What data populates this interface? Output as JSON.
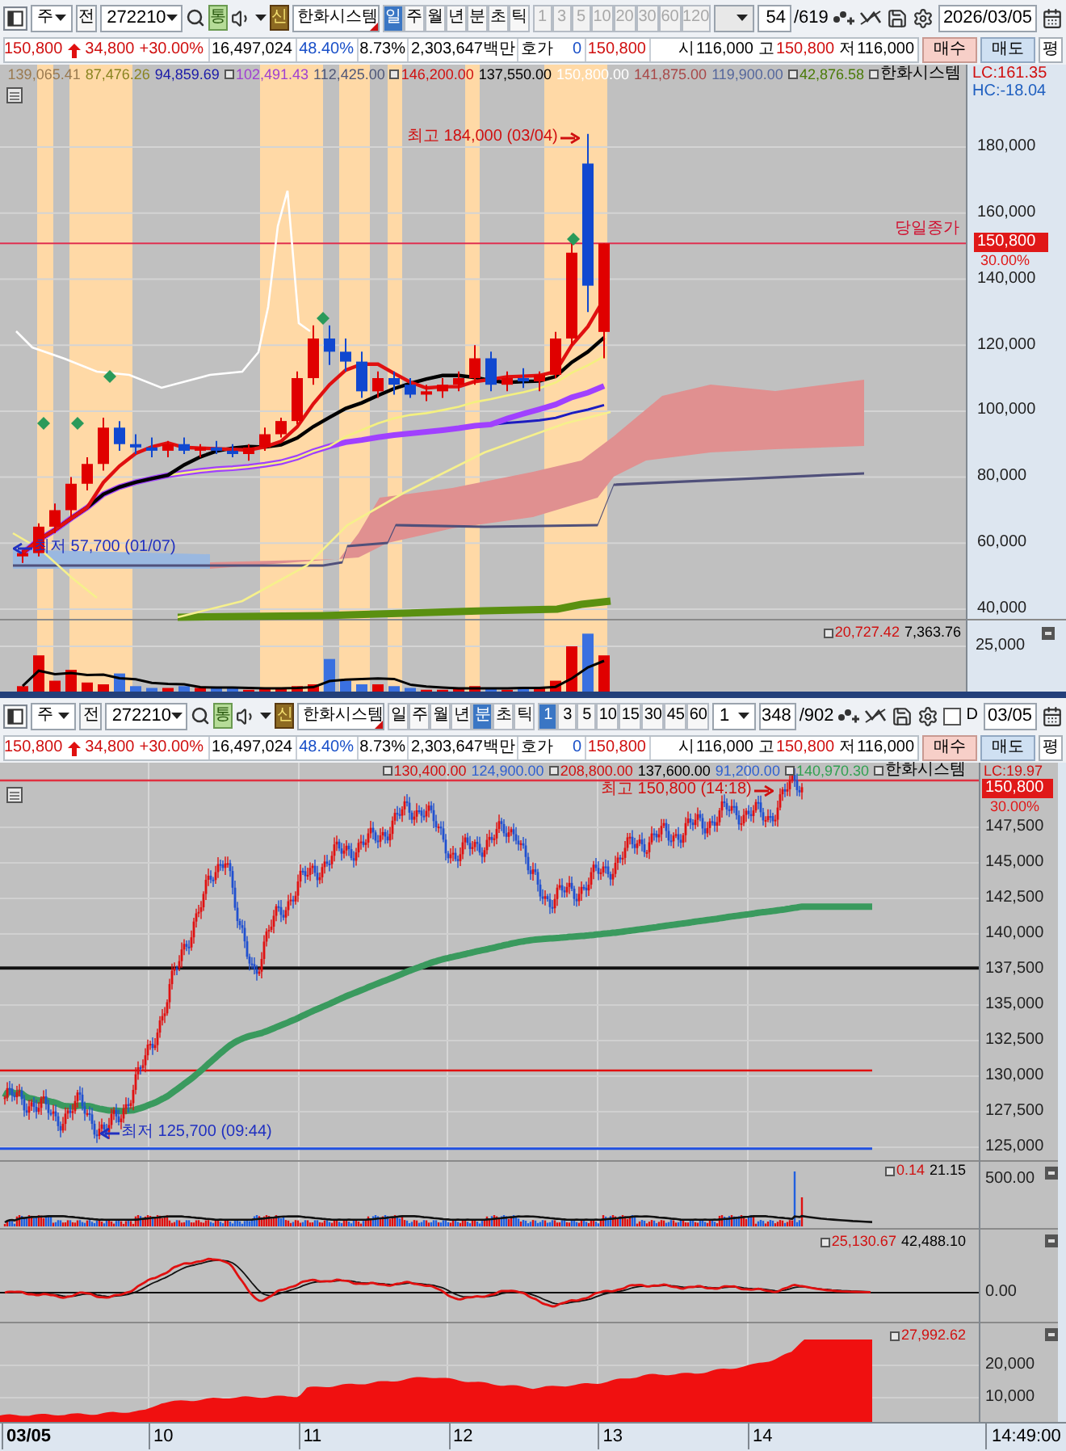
{
  "panels": [
    {
      "toolbar": {
        "market": "주",
        "mode": "전",
        "code": "272210",
        "flag": "통",
        "badge": "신",
        "name": "한화시스템",
        "periods": [
          {
            "label": "일",
            "selected": true
          },
          {
            "label": "주",
            "selected": false
          },
          {
            "label": "월",
            "selected": false
          },
          {
            "label": "년",
            "selected": false
          },
          {
            "label": "분",
            "selected": false
          },
          {
            "label": "초",
            "selected": false
          },
          {
            "label": "틱",
            "selected": false
          }
        ],
        "intervals": [
          {
            "label": "1",
            "selected": false
          },
          {
            "label": "3",
            "selected": false
          },
          {
            "label": "5",
            "selected": false
          },
          {
            "label": "10",
            "selected": false
          },
          {
            "label": "20",
            "selected": false
          },
          {
            "label": "30",
            "selected": false
          },
          {
            "label": "60",
            "selected": false
          },
          {
            "label": "120",
            "selected": false
          }
        ],
        "intervals_disabled": true,
        "count": "54",
        "total": "/619",
        "date": "2026/03/05"
      },
      "quote": {
        "rising": true,
        "price": "150,800",
        "change": "34,800",
        "change_rate": "+30.00%",
        "volume": "16,497,024",
        "ratio": "48.40%",
        "turnover": "8.73%",
        "amount": "2,303,647백만",
        "bid_label": "호가",
        "bid_volume": "0",
        "bid_price": "150,800",
        "ohlc": [
          {
            "label": "시",
            "value": "116,000",
            "color": "#000000"
          },
          {
            "label": "고",
            "value": "150,800",
            "color": "#d01010"
          },
          {
            "label": "저",
            "value": "116,000",
            "color": "#000000"
          }
        ],
        "buttons": [
          {
            "label": "매수",
            "kind": "buy"
          },
          {
            "label": "매도",
            "kind": "sell"
          },
          {
            "label": "평",
            "kind": "plain"
          }
        ]
      },
      "chart": {
        "kind": "daily",
        "legend": [
          {
            "value": "139,065.41",
            "color": "#9a7a50",
            "box": false,
            "kind": "value"
          },
          {
            "value": "87,476.26",
            "color": "#8a8420",
            "box": false,
            "kind": "value"
          },
          {
            "value": "94,859.69",
            "color": "#1a1aa8",
            "box": false,
            "kind": "value"
          },
          {
            "value": "102,491.43",
            "color": "#a040d0",
            "box": true,
            "kind": "value"
          },
          {
            "value": "112,425.00",
            "color": "#505878",
            "box": false,
            "kind": "value"
          },
          {
            "value": "146,200.00",
            "color": "#d01010",
            "box": true,
            "kind": "value"
          },
          {
            "value": "137,550.00",
            "color": "#000000",
            "box": false,
            "kind": "value"
          },
          {
            "value": "150,800.00",
            "color": "#ffffff",
            "box": false,
            "kind": "value"
          },
          {
            "value": "141,875.00",
            "color": "#a84848",
            "box": false,
            "kind": "value"
          },
          {
            "value": "119,900.00",
            "color": "#56689c",
            "box": false,
            "kind": "value"
          },
          {
            "value": "42,876.58",
            "color": "#4a7a08",
            "box": true,
            "kind": "value"
          },
          {
            "value": "한화시스템",
            "color": "#000000",
            "box": true,
            "kind": "name"
          }
        ],
        "lc": "LC:161.35",
        "hc": "HC:-18.04",
        "y_ticks": [
          "180,000",
          "160,000",
          "140,000",
          "120,000",
          "100,000",
          "80,000",
          "60,000",
          "40,000"
        ],
        "last_price": "150,800",
        "last_rate": "30.00%",
        "close_label": "당일종가",
        "high_note": "최고 184,000 (03/04)",
        "low_note": "최저 57,700 (01/07)",
        "volume": {
          "legend": [
            {
              "value": "20,727.42",
              "color": "#d01010",
              "box": true
            },
            {
              "value": "7,363.76",
              "color": "#000000",
              "box": false
            }
          ],
          "y_ticks": [
            "25,000"
          ]
        }
      }
    },
    {
      "toolbar": {
        "market": "주",
        "mode": "전",
        "code": "272210",
        "flag": "통",
        "badge": "신",
        "name": "한화시스템",
        "periods": [
          {
            "label": "일",
            "selected": false
          },
          {
            "label": "주",
            "selected": false
          },
          {
            "label": "월",
            "selected": false
          },
          {
            "label": "년",
            "selected": false
          },
          {
            "label": "분",
            "selected": true
          },
          {
            "label": "초",
            "selected": false
          },
          {
            "label": "틱",
            "selected": false
          }
        ],
        "intervals": [
          {
            "label": "1",
            "selected": true
          },
          {
            "label": "3",
            "selected": false
          },
          {
            "label": "5",
            "selected": false
          },
          {
            "label": "10",
            "selected": false
          },
          {
            "label": "15",
            "selected": false
          },
          {
            "label": "30",
            "selected": false
          },
          {
            "label": "45",
            "selected": false
          },
          {
            "label": "60",
            "selected": false
          }
        ],
        "intervals_disabled": false,
        "interval_select": "1",
        "count": "348",
        "total": "/902",
        "option_checkbox": {
          "label": "D",
          "checked": false
        },
        "date": "03/05"
      },
      "quote": {
        "rising": true,
        "price": "150,800",
        "change": "34,800",
        "change_rate": "+30.00%",
        "volume": "16,497,024",
        "ratio": "48.40%",
        "turnover": "8.73%",
        "amount": "2,303,647백만",
        "bid_label": "호가",
        "bid_volume": "0",
        "bid_price": "150,800",
        "ohlc": [
          {
            "label": "시",
            "value": "116,000",
            "color": "#000000"
          },
          {
            "label": "고",
            "value": "150,800",
            "color": "#d01010"
          },
          {
            "label": "저",
            "value": "116,000",
            "color": "#000000"
          }
        ],
        "buttons": [
          {
            "label": "매수",
            "kind": "buy"
          },
          {
            "label": "매도",
            "kind": "sell"
          },
          {
            "label": "평",
            "kind": "plain"
          }
        ]
      },
      "chart": {
        "kind": "minute",
        "legend": [
          {
            "value": "130,400.00",
            "color": "#d01010",
            "box": true,
            "kind": "value"
          },
          {
            "value": "124,900.00",
            "color": "#3060d0",
            "box": false,
            "kind": "value"
          },
          {
            "value": "208,800.00",
            "color": "#d01010",
            "box": true,
            "kind": "value"
          },
          {
            "value": "137,600.00",
            "color": "#000000",
            "box": false,
            "kind": "value"
          },
          {
            "value": "91,200.00",
            "color": "#3060d0",
            "box": false,
            "kind": "value"
          },
          {
            "value": "140,970.30",
            "color": "#30a050",
            "box": true,
            "kind": "value"
          },
          {
            "value": "한화시스템",
            "color": "#000000",
            "box": true,
            "kind": "name"
          }
        ],
        "lc": "LC:19.97",
        "y_ticks": [
          "147,500",
          "145,000",
          "142,500",
          "140,000",
          "137,500",
          "135,000",
          "132,500",
          "130,000",
          "127,500",
          "125,000"
        ],
        "last_price": "150,800",
        "last_rate": "30.00%",
        "high_note": "최고 150,800 (14:18)",
        "low_note": "최저 125,700 (09:44)",
        "sub_panes": [
          {
            "legend": [
              {
                "value": "0.14",
                "color": "#d01010",
                "box": true
              },
              {
                "value": "21.15",
                "color": "#000000",
                "box": false
              }
            ],
            "y_ticks": [
              "500.00"
            ]
          },
          {
            "legend": [
              {
                "value": "25,130.67",
                "color": "#d01010",
                "box": true
              },
              {
                "value": "42,488.10",
                "color": "#000000",
                "box": false
              }
            ],
            "y_ticks": [
              "0.00"
            ]
          },
          {
            "legend": [
              {
                "value": "27,992.62",
                "color": "#d01010",
                "box": true
              }
            ],
            "y_ticks": [
              "20,000",
              "10,000"
            ]
          }
        ],
        "x_ticks": [
          "03/05",
          "10",
          "11",
          "12",
          "13",
          "14"
        ],
        "time": "14:49:00"
      }
    }
  ]
}
